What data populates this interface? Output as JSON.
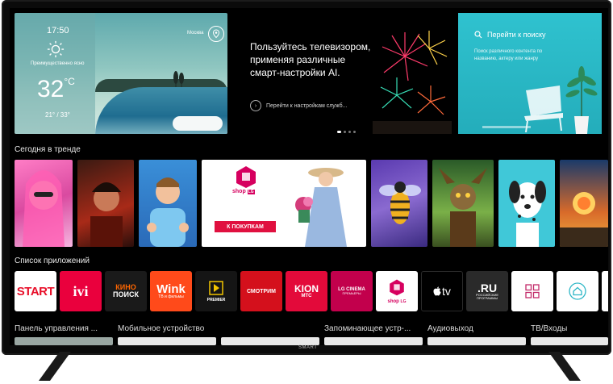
{
  "weather": {
    "time": "17:50",
    "condition": "Преимущественно ясно",
    "temp": "32",
    "unit": "°C",
    "range": "21° / 33°",
    "city": "Москва"
  },
  "promo": {
    "headline": "Пользуйтесь телевизором, применяя различные смарт-настройки AI.",
    "link": "Перейти к настройкам служб..."
  },
  "search": {
    "title": "Перейти к поиску",
    "description": "Поиск различного контента по названию, актеру или жанру"
  },
  "trending": {
    "title": "Сегодня в тренде",
    "banner_logo": "shop",
    "banner_logo_sub": "LG",
    "banner_button": "К ПОКУПКАМ"
  },
  "apps": {
    "title": "Список приложений",
    "items": [
      {
        "l1": "START",
        "l2": ""
      },
      {
        "l1": "ivi",
        "l2": ""
      },
      {
        "l1": "КИНО",
        "l2": "ПОИСК"
      },
      {
        "l1": "Wink",
        "l2": "ТВ и фильмы"
      },
      {
        "l1": "PREMIER",
        "l2": ""
      },
      {
        "l1": "СМОТРИМ",
        "l2": ""
      },
      {
        "l1": "KION",
        "l2": "МТС"
      },
      {
        "l1": "LG CINEMA",
        "l2": "ПРЕМЬЕРЫ"
      },
      {
        "l1": "shop",
        "l2": "LG"
      },
      {
        "l1": "tv",
        "l2": ""
      },
      {
        "l1": ".RU",
        "l2": "РОССИЙСКИЕ ПРОГРАММЫ"
      }
    ]
  },
  "bottom": {
    "items": [
      "Панель управления ...",
      "Мобильное устройство",
      "Запоминающее устр-...",
      "Аудиовыход",
      "ТВ/Входы"
    ]
  },
  "brand": "SMART",
  "colors": {
    "accent": "#c8003c",
    "search_card": "#2fc2cf",
    "screen_bg": "#000000"
  }
}
